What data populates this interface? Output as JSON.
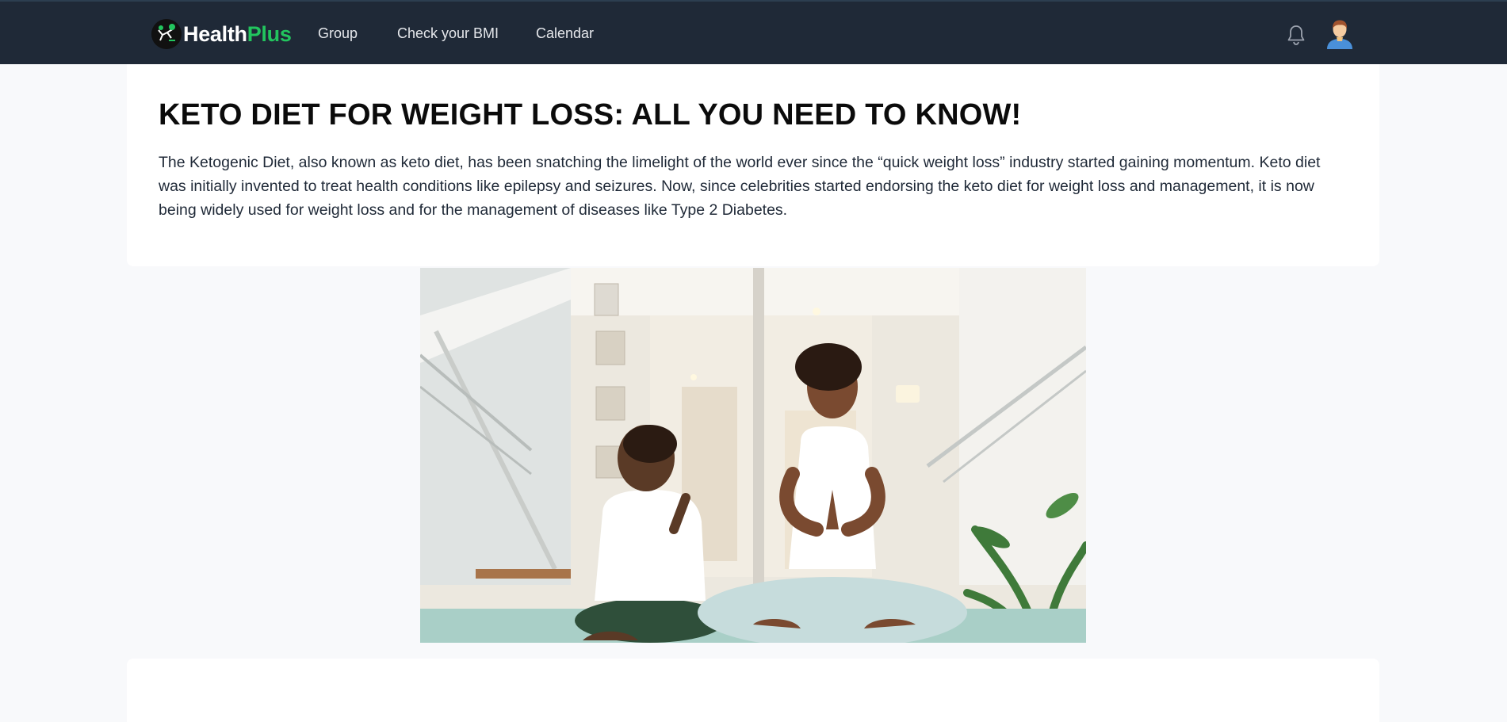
{
  "brand": {
    "name_part1": "Health",
    "name_part2": "Plus",
    "accent_color": "#22c55e",
    "navbar_color": "#1f2937"
  },
  "nav": {
    "links": [
      {
        "label": "Group"
      },
      {
        "label": "Check your BMI"
      },
      {
        "label": "Calendar"
      }
    ],
    "icons": {
      "notifications": "bell-icon",
      "profile": "user-avatar-icon"
    }
  },
  "article": {
    "title": "KETO DIET FOR WEIGHT LOSS: ALL YOU NEED TO KNOW!",
    "intro": "The Ketogenic Diet, also known as keto diet, has been snatching the limelight of the world ever since the “quick weight loss” industry started gaining momentum. Keto diet was initially invented to treat health conditions like epilepsy and seizures. Now, since celebrities started endorsing the keto diet for weight loss and management, it is now being widely used for weight loss and for the management of diseases like Type 2 Diabetes."
  }
}
